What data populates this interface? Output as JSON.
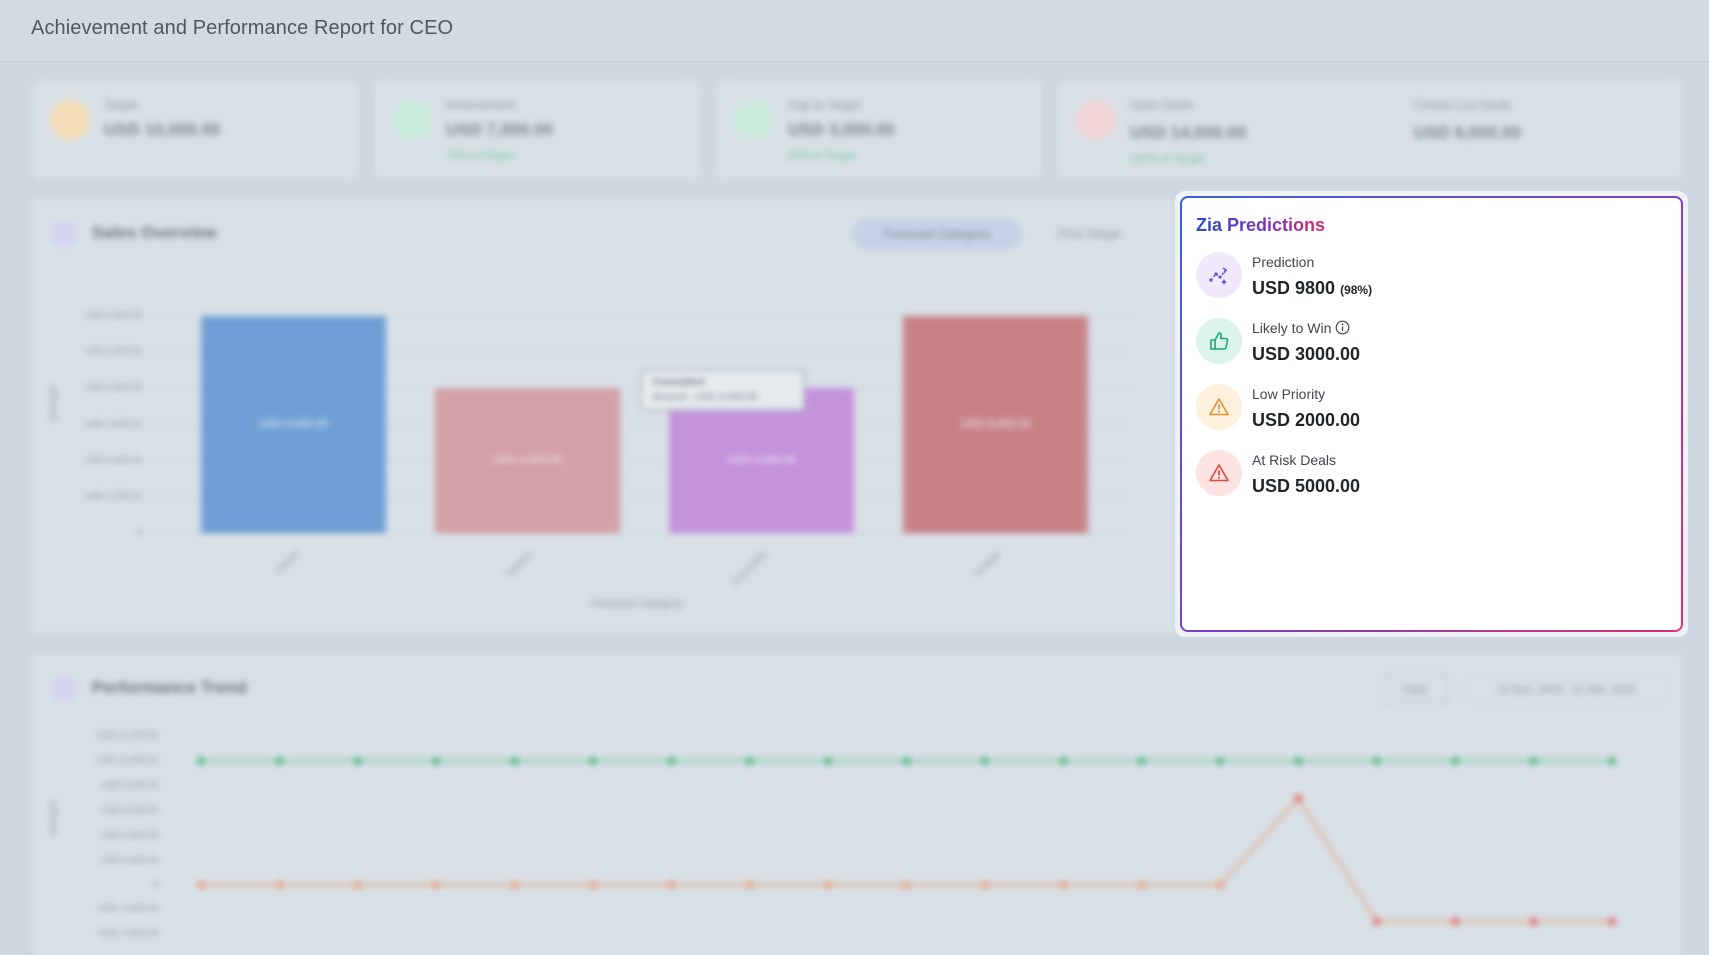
{
  "page": {
    "title": "Achievement and Performance Report for  CEO"
  },
  "kpis": [
    {
      "label": "Target",
      "value": "USD 10,000.00",
      "sub": ""
    },
    {
      "label": "Achievement",
      "value": "USD 7,000.00",
      "sub": "70% of Target"
    },
    {
      "label": "Gap to Target",
      "value": "USD 3,000.00",
      "sub": "30% of Target"
    },
    {
      "label": "Open Deals",
      "value": "USD 14,000.00",
      "sub": "140% of Target"
    },
    {
      "label": "Closed Lost Deals",
      "value": "USD 6,000.00",
      "sub": ""
    }
  ],
  "sales_overview": {
    "title": "Sales Overview",
    "tab_active": "Forecast Category",
    "tab_inactive": "First Stage",
    "ylabel": "Amount",
    "xlabel": "Forecast Category",
    "y_ticks": [
      "USD 6,000.00",
      "USD 5,000.00",
      "USD 4,000.00",
      "USD 3,000.00",
      "USD 2,000.00",
      "USD 1,000.00",
      "0"
    ],
    "tooltip": {
      "title": "Committed",
      "text": "Amount : USD 4,000.00"
    }
  },
  "chart_data": [
    {
      "type": "bar",
      "title": "Sales Overview",
      "xlabel": "Forecast Category",
      "ylabel": "Amount",
      "categories": [
        "Closed",
        "Pipeline",
        "Committed",
        "Omitted"
      ],
      "values": [
        6000,
        4000,
        4000,
        6000
      ],
      "data_labels": [
        "USD 6,000.00",
        "USD 4,000.00",
        "USD 4,000.00",
        "USD 6,000.00"
      ],
      "ylim": [
        0,
        6000
      ],
      "colors": [
        "#6f9fd6",
        "#d3a0a5",
        "#c592dc",
        "#c88287"
      ]
    },
    {
      "type": "line",
      "title": "Performance Trend",
      "ylabel": "Amount",
      "series": [
        {
          "values": [
            10000,
            10000,
            10000,
            10000,
            10000,
            10000,
            10000,
            10000,
            10000,
            10000,
            10000,
            10000,
            10000,
            10000,
            10000,
            10000,
            10000,
            10000,
            10000
          ]
        },
        {
          "values": [
            0,
            0,
            0,
            0,
            0,
            0,
            0,
            0,
            0,
            0,
            0,
            0,
            0,
            0,
            7000,
            -3000,
            -3000,
            -3000,
            -3000
          ]
        }
      ],
      "ylim": [
        -4000,
        11000
      ]
    }
  ],
  "performance_trend": {
    "title": "Performance Trend",
    "period_select": "Daily",
    "date_range": "12 Dec, 2024 - 11 Mar, 2025",
    "ylabel": "Amount",
    "y_ticks": [
      "USD 11,000.00",
      "USD 10,000.00",
      "USD 8,000.00",
      "USD 6,000.00",
      "USD 4,000.00",
      "USD 2,000.00",
      "0",
      "USD -2,000.00",
      "USD -4,000.00"
    ]
  },
  "zia": {
    "title": "Zia Predictions",
    "items": [
      {
        "label": "Prediction",
        "value": "USD 9800",
        "extra": "(98%)",
        "icon": "trend-prediction-icon",
        "color": "#6b4bd6",
        "bg": "#efe9fb"
      },
      {
        "label": "Likely to Win",
        "value": "USD 3000.00",
        "extra": "",
        "icon": "thumbs-up-icon",
        "color": "#1fa676",
        "bg": "#dcf5ec"
      },
      {
        "label": "Low Priority",
        "value": "USD 2000.00",
        "extra": "",
        "icon": "warning-icon",
        "color": "#e0912b",
        "bg": "#fdf0dc"
      },
      {
        "label": "At Risk Deals",
        "value": "USD 5000.00",
        "extra": "",
        "icon": "alert-icon",
        "color": "#e0473f",
        "bg": "#fde4e3"
      }
    ]
  }
}
